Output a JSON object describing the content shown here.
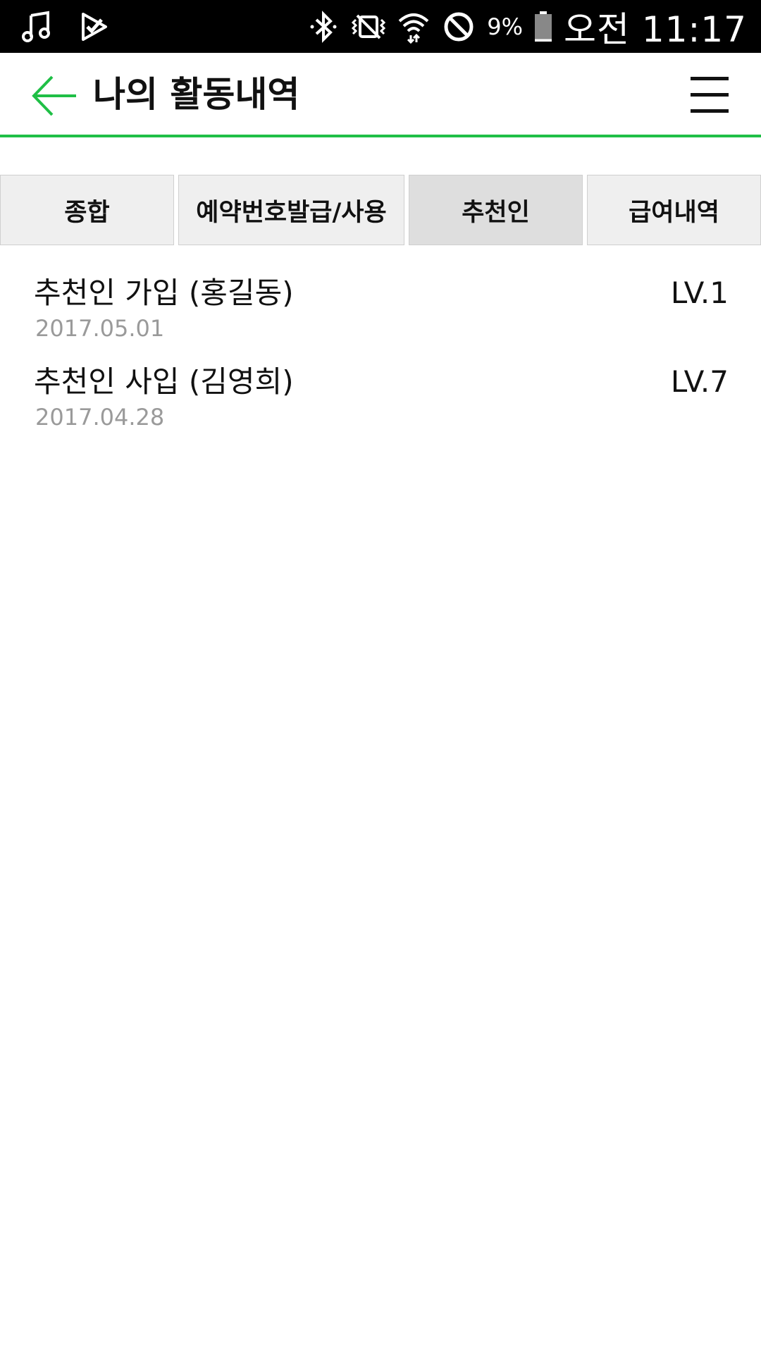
{
  "status_bar": {
    "left_icons": [
      "music-icon",
      "check-task-icon"
    ],
    "right_icons": [
      "bluetooth-icon",
      "vibrate-mute-icon",
      "wifi-icon",
      "do-not-disturb-icon",
      "battery-icon"
    ],
    "battery_percent": "9%",
    "battery_level": 0.09,
    "time": "오전 11:17"
  },
  "header": {
    "title": "나의 활동내역",
    "back_icon": "arrow-left-icon",
    "menu_icon": "hamburger-menu-icon",
    "accent_color": "#1fbf46"
  },
  "tabs": [
    {
      "label": "종합",
      "active": false
    },
    {
      "label": "예약번호발급/사용",
      "active": false
    },
    {
      "label": "추천인",
      "active": true
    },
    {
      "label": "급여내역",
      "active": false
    }
  ],
  "activity_list": [
    {
      "title": "추천인 가입 (홍길동)",
      "date": "2017.05.01",
      "level": "LV.1"
    },
    {
      "title": "추천인 사입 (김영희)",
      "date": "2017.04.28",
      "level": "LV.7"
    }
  ]
}
